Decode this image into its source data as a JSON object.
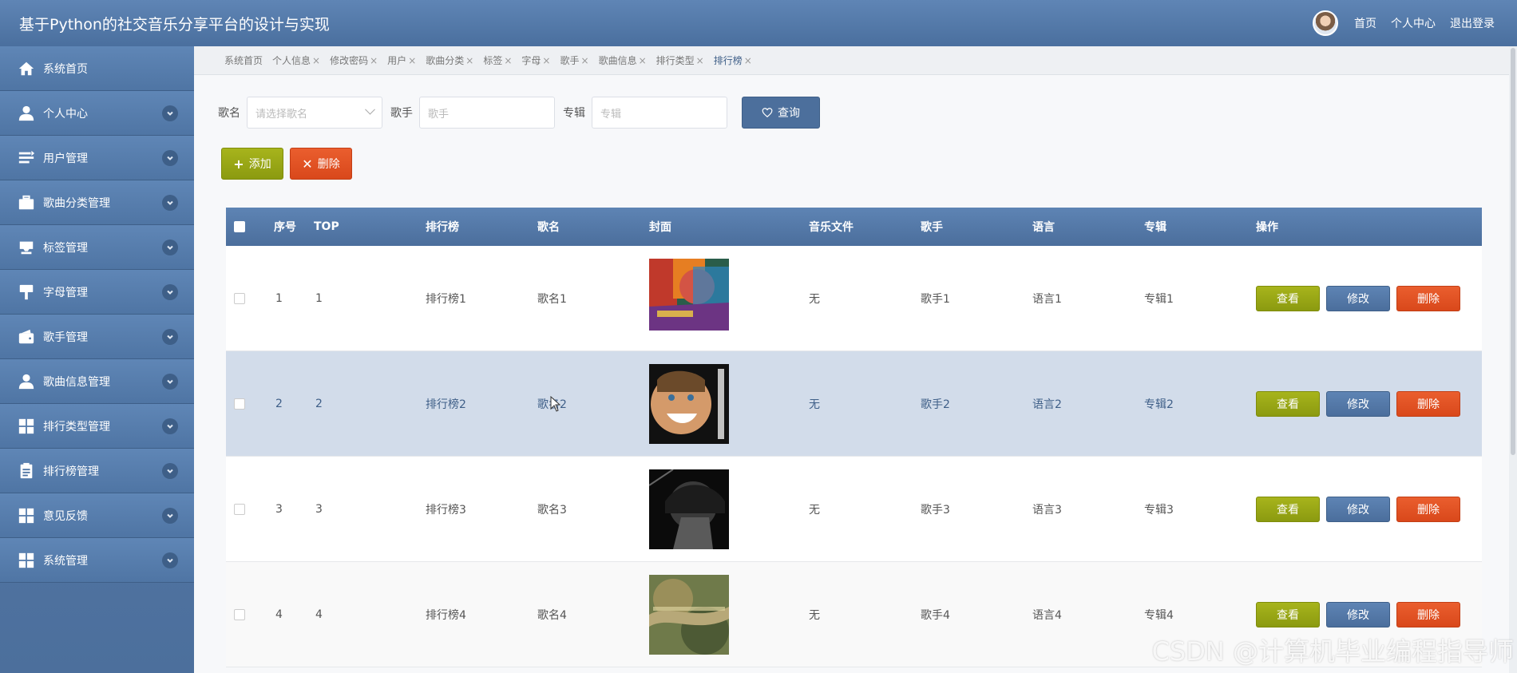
{
  "header": {
    "title": "基于Python的社交音乐分享平台的设计与实现",
    "links": [
      "首页",
      "个人中心",
      "退出登录"
    ]
  },
  "sidebar": {
    "items": [
      {
        "label": "系统首页",
        "icon": "home-icon",
        "chevron": false
      },
      {
        "label": "个人中心",
        "icon": "user-icon",
        "chevron": true
      },
      {
        "label": "用户管理",
        "icon": "list-icon",
        "chevron": true
      },
      {
        "label": "歌曲分类管理",
        "icon": "briefcase-icon",
        "chevron": true
      },
      {
        "label": "标签管理",
        "icon": "tray-icon",
        "chevron": true
      },
      {
        "label": "字母管理",
        "icon": "brush-icon",
        "chevron": true
      },
      {
        "label": "歌手管理",
        "icon": "wallet-icon",
        "chevron": true
      },
      {
        "label": "歌曲信息管理",
        "icon": "user-icon",
        "chevron": true
      },
      {
        "label": "排行类型管理",
        "icon": "grid-icon",
        "chevron": true
      },
      {
        "label": "排行榜管理",
        "icon": "clipboard-icon",
        "chevron": true
      },
      {
        "label": "意见反馈",
        "icon": "grid-icon",
        "chevron": true
      },
      {
        "label": "系统管理",
        "icon": "grid-icon",
        "chevron": true
      }
    ]
  },
  "tabs": [
    {
      "label": "系统首页",
      "closable": false
    },
    {
      "label": "个人信息",
      "closable": true
    },
    {
      "label": "修改密码",
      "closable": true
    },
    {
      "label": "用户",
      "closable": true
    },
    {
      "label": "歌曲分类",
      "closable": true
    },
    {
      "label": "标签",
      "closable": true
    },
    {
      "label": "字母",
      "closable": true
    },
    {
      "label": "歌手",
      "closable": true
    },
    {
      "label": "歌曲信息",
      "closable": true
    },
    {
      "label": "排行类型",
      "closable": true
    },
    {
      "label": "排行榜",
      "closable": true,
      "active": true
    }
  ],
  "tab_close_glyph": "×",
  "search": {
    "song_label": "歌名",
    "song_placeholder": "请选择歌名",
    "singer_label": "歌手",
    "singer_placeholder": "歌手",
    "album_label": "专辑",
    "album_placeholder": "专辑",
    "query_button": "查询"
  },
  "actions": {
    "add": "添加",
    "delete": "删除"
  },
  "table": {
    "columns": [
      "序号",
      "TOP",
      "排行榜",
      "歌名",
      "封面",
      "音乐文件",
      "歌手",
      "语言",
      "专辑",
      "操作"
    ],
    "rows": [
      {
        "index": "1",
        "top": "1",
        "chart": "排行榜1",
        "song": "歌名1",
        "file": "无",
        "singer": "歌手1",
        "language": "语言1",
        "album": "专辑1"
      },
      {
        "index": "2",
        "top": "2",
        "chart": "排行榜2",
        "song": "歌名2",
        "file": "无",
        "singer": "歌手2",
        "language": "语言2",
        "album": "专辑2"
      },
      {
        "index": "3",
        "top": "3",
        "chart": "排行榜3",
        "song": "歌名3",
        "file": "无",
        "singer": "歌手3",
        "language": "语言3",
        "album": "专辑3"
      },
      {
        "index": "4",
        "top": "4",
        "chart": "排行榜4",
        "song": "歌名4",
        "file": "无",
        "singer": "歌手4",
        "language": "语言4",
        "album": "专辑4"
      }
    ],
    "ops": {
      "view": "查看",
      "edit": "修改",
      "delete": "删除"
    }
  },
  "watermark": "CSDN @计算机毕业编程指导师",
  "colors": {
    "primary": "#4c6f9c",
    "green": "#98a516",
    "orange": "#e0532a",
    "hover_row": "#d2dcea"
  }
}
